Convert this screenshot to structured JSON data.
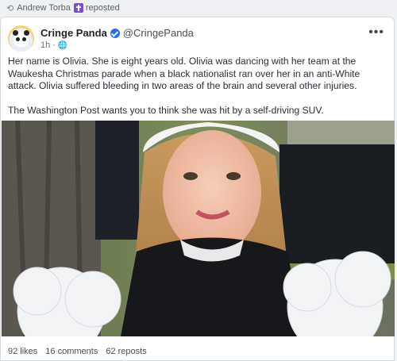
{
  "repost": {
    "user": "Andrew Torba",
    "label": "reposted"
  },
  "post": {
    "author_name": "Cringe Panda",
    "handle": "@CringePanda",
    "time": "1h",
    "paragraph1": "Her name is Olivia. She is eight years old. Olivia was dancing with her team at the Waukesha Christmas parade when a black nationalist ran over her in an anti-White attack. Olivia suffered bleeding in two areas of the brain and several other injuries.",
    "paragraph2": "The Washington Post wants you to think she was hit by a self-driving SUV."
  },
  "stats": {
    "likes": "92 likes",
    "comments": "16 comments",
    "reposts": "62 reposts"
  },
  "icons": {
    "repost": "repost-icon",
    "badge": "cross-badge-icon",
    "verified": "verified-icon",
    "visibility": "globe-icon",
    "more": "more-options-icon"
  },
  "colors": {
    "verified": "#1d72e8",
    "badge": "#7b4fc9"
  }
}
